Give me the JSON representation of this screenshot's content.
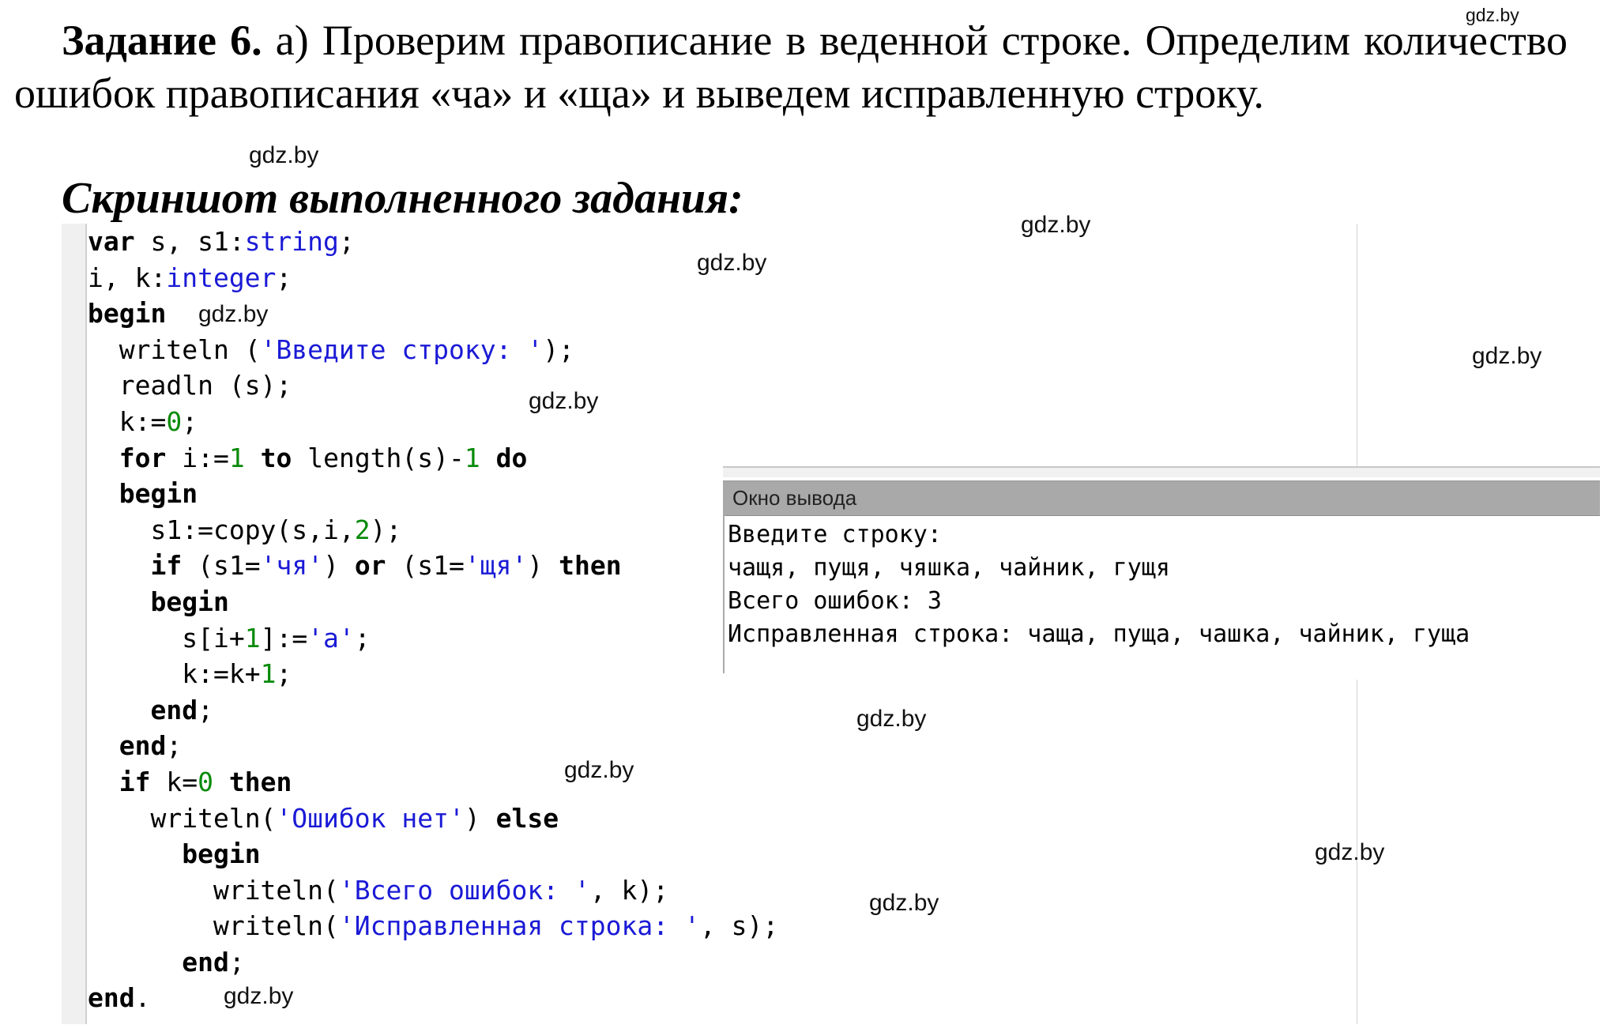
{
  "task": {
    "label": "Задание 6.",
    "text": "а) Проверим правописание в веденной строке. Определим количество ошибок правописания «ча» и «ща» и выведем исправленную строку."
  },
  "caption": "Скриншот выполненного задания:",
  "watermark": "gdz.by",
  "code": {
    "line1": {
      "a": "var",
      "b": " s, s1:",
      "c": "string",
      "d": ";"
    },
    "line2": {
      "a": "i, k:",
      "b": "integer",
      "c": ";"
    },
    "line3": {
      "a": "begin"
    },
    "line4": {
      "a": "writeln (",
      "b": "'Введите строку: '",
      "c": ");"
    },
    "line5": {
      "a": "readln (s);"
    },
    "line6": {
      "a": "k:=",
      "b": "0",
      "c": ";"
    },
    "line7": {
      "a": "for",
      "b": " i:=",
      "c": "1",
      "d": " ",
      "e": "to",
      "f": " length(s)-",
      "g": "1",
      "h": " ",
      "i": "do"
    },
    "line8": {
      "a": "begin"
    },
    "line9": {
      "a": "s1:=copy(s,i,",
      "b": "2",
      "c": ");"
    },
    "line10": {
      "a": "if",
      "b": " (s1=",
      "c": "'чя'",
      "d": ") ",
      "e": "or",
      "f": " (s1=",
      "g": "'щя'",
      "h": ") ",
      "i": "then"
    },
    "line11": {
      "a": "begin"
    },
    "line12": {
      "a": "s[i+",
      "b": "1",
      "c": "]:=",
      "d": "'a'",
      "e": ";"
    },
    "line13": {
      "a": "k:=k+",
      "b": "1",
      "c": ";"
    },
    "line14": {
      "a": "end",
      "b": ";"
    },
    "line15": {
      "a": "end",
      "b": ";"
    },
    "line16": {
      "a": "if",
      "b": " k=",
      "c": "0",
      "d": " ",
      "e": "then"
    },
    "line17": {
      "a": "writeln(",
      "b": "'Ошибок нет'",
      "c": ") ",
      "d": "else"
    },
    "line18": {
      "a": "begin"
    },
    "line19": {
      "a": "writeln(",
      "b": "'Всего ошибок: '",
      "c": ", k);"
    },
    "line20": {
      "a": "writeln(",
      "b": "'Исправленная строка: '",
      "c": ", s);"
    },
    "line21": {
      "a": "end",
      "b": ";"
    },
    "line22": {
      "a": "end",
      "b": "."
    }
  },
  "output": {
    "title": "Окно вывода",
    "lines": [
      "Введите строку:",
      "чащя, пущя, чяшка, чайник, гущя",
      "Всего ошибок: 3",
      "Исправленная строка: чаща, пуща, чашка, чайник, гуща"
    ]
  }
}
